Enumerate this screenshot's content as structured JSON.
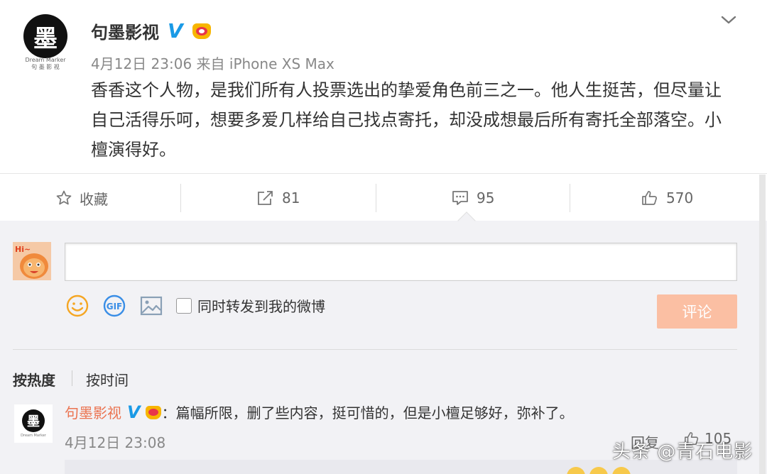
{
  "post": {
    "avatar_char": "墨",
    "avatar_sub_line1": "Dream Marker",
    "avatar_sub_line2": "句 墨 影 视",
    "author": "句墨影视",
    "verified_mark": "V",
    "meta": "4月12日 23:06 来自 iPhone XS Max",
    "content": "香香这个人物，是我们所有人投票选出的挚爱角色前三之一。他人生挺苦，但尽量让自己活得乐呵，想要多爱几样给自己找点寄托，却没成想最后所有寄托全部落空。小檀演得好。"
  },
  "actions": {
    "favorite_label": "收藏",
    "repost_count": "81",
    "comment_count": "95",
    "like_count": "570"
  },
  "composer": {
    "placeholder": "",
    "forward_label": "同时转发到我的微博",
    "submit_label": "评论",
    "user_avatar_text": "Hi~"
  },
  "sort": {
    "by_hot": "按热度",
    "by_time": "按时间"
  },
  "comment": {
    "avatar_char": "墨",
    "avatar_sub": "Dream Marker",
    "author": "句墨影视",
    "verified_mark": "V",
    "text": "：篇幅所限，删了些内容，挺可惜的，但是小檀足够好，弥补了。",
    "time": "4月12日 23:08",
    "reply_label": "回复",
    "like_count": "105"
  },
  "watermark": "头条 @青石电影",
  "colors": {
    "accent": "#eb7350",
    "verified": "#1a9ae6",
    "submit_bg": "#fbbfa3",
    "panel_bg": "#f2f2f5"
  },
  "icons": [
    "chevron-down-icon",
    "star-icon",
    "share-icon",
    "comment-icon",
    "thumbs-up-icon",
    "emoji-icon",
    "gif-icon",
    "image-icon"
  ]
}
